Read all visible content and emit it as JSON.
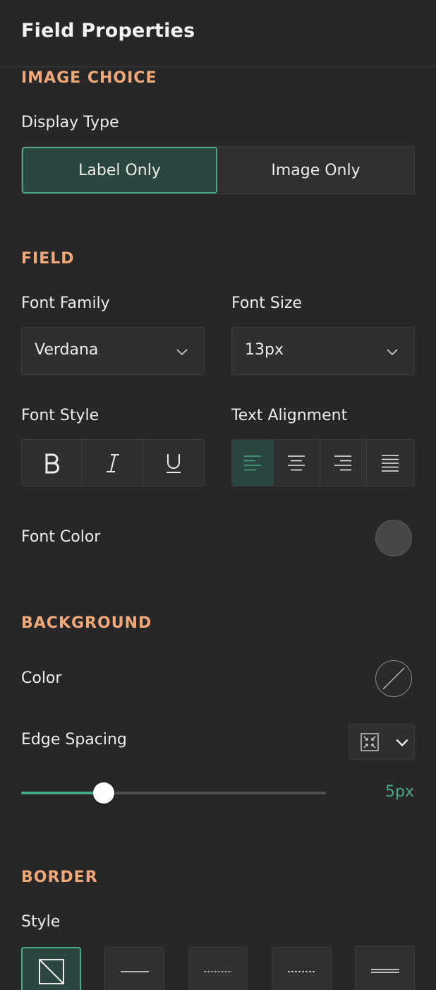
{
  "panel": {
    "title": "Field Properties"
  },
  "image_choice": {
    "section_title": "IMAGE CHOICE",
    "display_type_label": "Display Type",
    "options": [
      "Label Only",
      "Image Only"
    ],
    "selected": "Label Only"
  },
  "field": {
    "section_title": "FIELD",
    "font_family_label": "Font Family",
    "font_family_value": "Verdana",
    "font_size_label": "Font Size",
    "font_size_value": "13px",
    "font_style_label": "Font Style",
    "font_style_buttons": [
      "bold-icon",
      "italic-icon",
      "underline-icon"
    ],
    "text_alignment_label": "Text Alignment",
    "alignment_buttons": [
      "align-left-icon",
      "align-center-icon",
      "align-right-icon",
      "align-justify-icon"
    ],
    "alignment_selected": "align-left-icon",
    "font_color_label": "Font Color",
    "font_color_value": "#474747"
  },
  "background": {
    "section_title": "BACKGROUND",
    "color_label": "Color",
    "color_value": "none",
    "edge_spacing_label": "Edge Spacing",
    "edge_spacing_value": "5px",
    "edge_spacing_fraction": 0.27
  },
  "border": {
    "section_title": "BORDER",
    "style_label": "Style",
    "styles": [
      "none",
      "solid",
      "dotted",
      "dashed",
      "double"
    ],
    "selected": "none"
  },
  "colors": {
    "background": "#272727",
    "accent": "#4aa887",
    "section_title": "#f0a878",
    "active_fill": "#2b4540"
  }
}
